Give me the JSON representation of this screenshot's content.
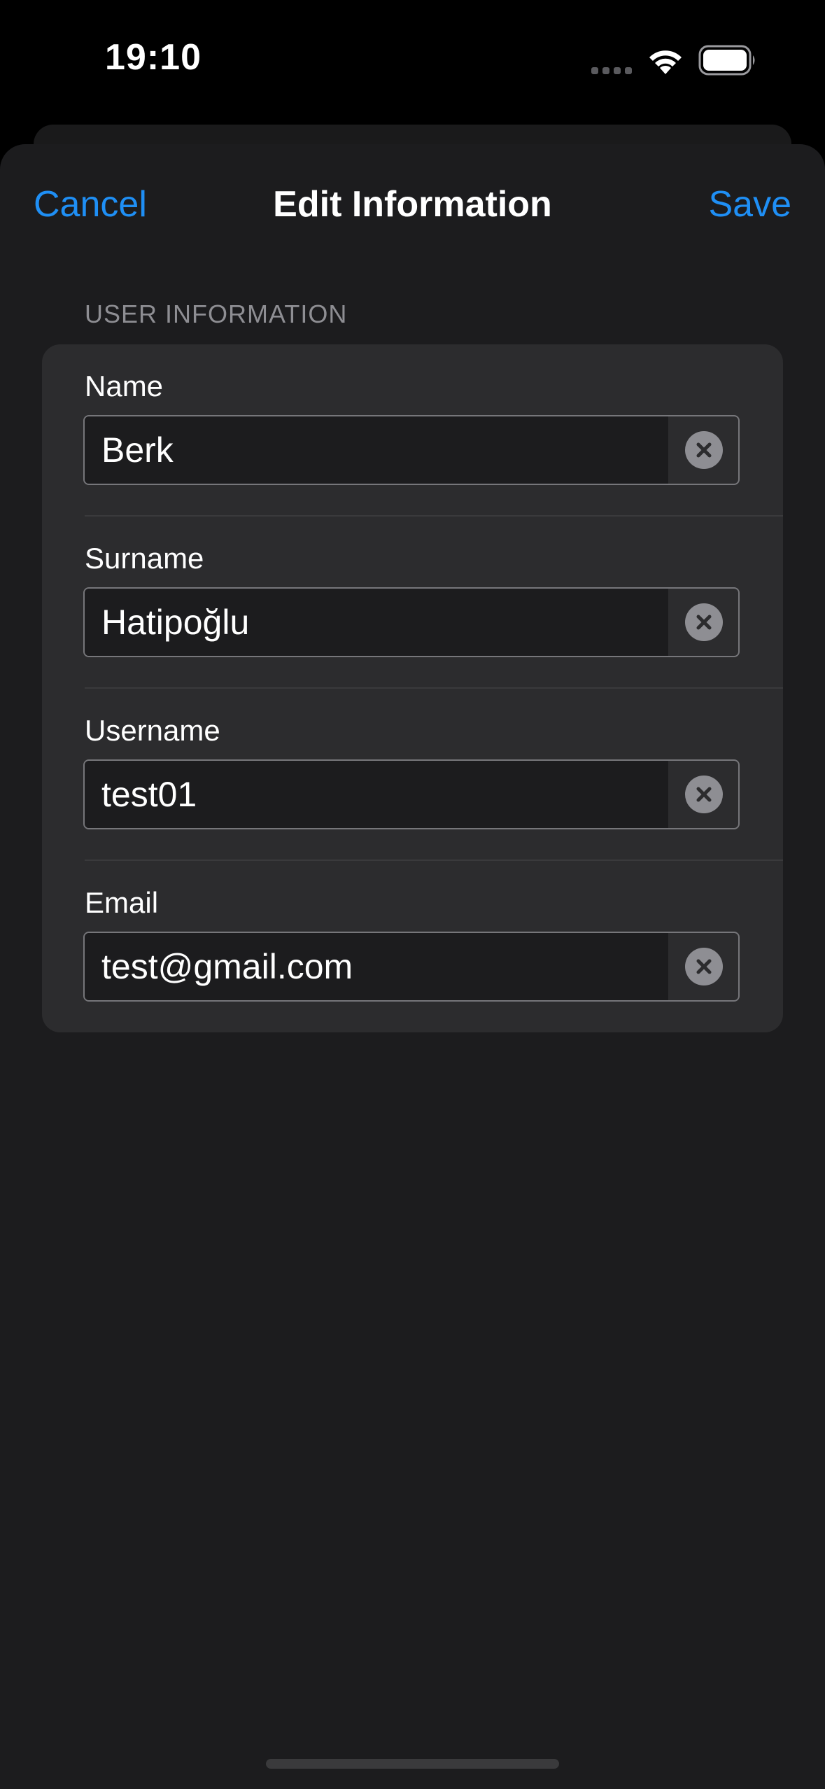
{
  "status_bar": {
    "time": "19:10",
    "icons": [
      "signal-dots-icon",
      "wifi-icon",
      "battery-icon"
    ]
  },
  "nav": {
    "cancel_label": "Cancel",
    "title": "Edit Information",
    "save_label": "Save"
  },
  "section": {
    "header": "USER INFORMATION"
  },
  "fields": [
    {
      "label": "Name",
      "value": "Berk"
    },
    {
      "label": "Surname",
      "value": "Hatipoğlu"
    },
    {
      "label": "Username",
      "value": "test01"
    },
    {
      "label": "Email",
      "value": "test@gmail.com"
    }
  ],
  "colors": {
    "accent": "#1f8ff5",
    "background": "#1c1c1e",
    "card": "#2c2c2e",
    "secondary_text": "#8e8e93"
  }
}
